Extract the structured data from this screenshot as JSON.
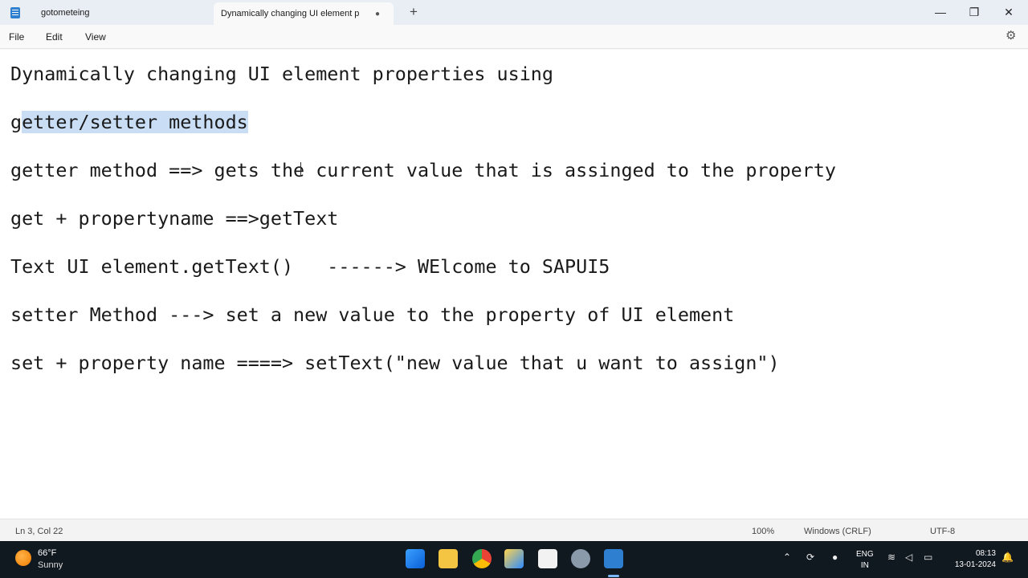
{
  "tabs": [
    {
      "title": "gotometeing"
    },
    {
      "title": "Dynamically changing UI element p",
      "unsaved_marker": "●"
    }
  ],
  "window_controls": {
    "new_tab": "+",
    "minimize": "—",
    "restore": "❐",
    "close": "✕"
  },
  "menu": {
    "file": "File",
    "edit": "Edit",
    "view": "View"
  },
  "editor": {
    "lines": [
      "Dynamically changing UI element properties using",
      "g",
      "etter/setter methods",
      "getter method ==> gets the current value that is assinged to the property",
      "get + propertyname ==>getText",
      "Text UI element.getText()   ------> WElcome to SAPUI5",
      "setter Method ---> set a new value to the property of UI element",
      "set + property name ====> setText(\"new value that u want to assign\")"
    ],
    "selection_color": "#c9def5"
  },
  "status": {
    "position": "Ln 3, Col 22",
    "zoom": "100%",
    "line_ending": "Windows (CRLF)",
    "encoding": "UTF-8"
  },
  "taskbar": {
    "weather": {
      "temp": "66°F",
      "condition": "Sunny"
    },
    "language": {
      "line1": "ENG",
      "line2": "IN"
    },
    "clock": {
      "time": "08:13",
      "date": "13-01-2024"
    }
  }
}
